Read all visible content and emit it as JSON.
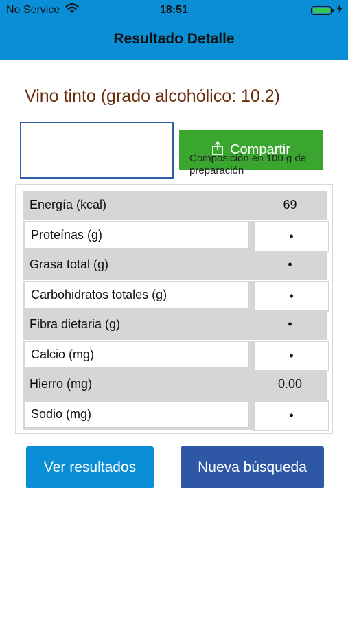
{
  "status_bar": {
    "carrier": "No Service",
    "time": "18:51",
    "wifi_icon": "wifi-icon",
    "battery_icon": "battery-icon",
    "charging_icon": "charging-bolt-icon"
  },
  "nav": {
    "title": "Resultado Detalle"
  },
  "food": {
    "title": "Vino tinto (grado alcohólico: 10.2)"
  },
  "share": {
    "label": "Compartir",
    "icon": "share-icon",
    "composition_note": "Composición en 100 g de preparación"
  },
  "nutrients": [
    {
      "label": "Energía (kcal)",
      "value": "69"
    },
    {
      "label": "Proteínas (g)",
      "value": "•"
    },
    {
      "label": "Grasa total (g)",
      "value": "•"
    },
    {
      "label": "Carbohidratos totales (g)",
      "value": "•"
    },
    {
      "label": "Fibra dietaria (g)",
      "value": "•"
    },
    {
      "label": "Calcio (mg)",
      "value": "•"
    },
    {
      "label": "Hierro (mg)",
      "value": "0.00"
    },
    {
      "label": "Sodio (mg)",
      "value": "•"
    }
  ],
  "actions": {
    "results_label": "Ver resultados",
    "new_search_label": "Nueva búsqueda"
  },
  "colors": {
    "header": "#0a8fd6",
    "title_text": "#6b2e0c",
    "share_button": "#3aa52f",
    "results_button": "#0a8fd6",
    "new_search_button": "#2e58a6",
    "row_shade": "#d6d6d6"
  }
}
